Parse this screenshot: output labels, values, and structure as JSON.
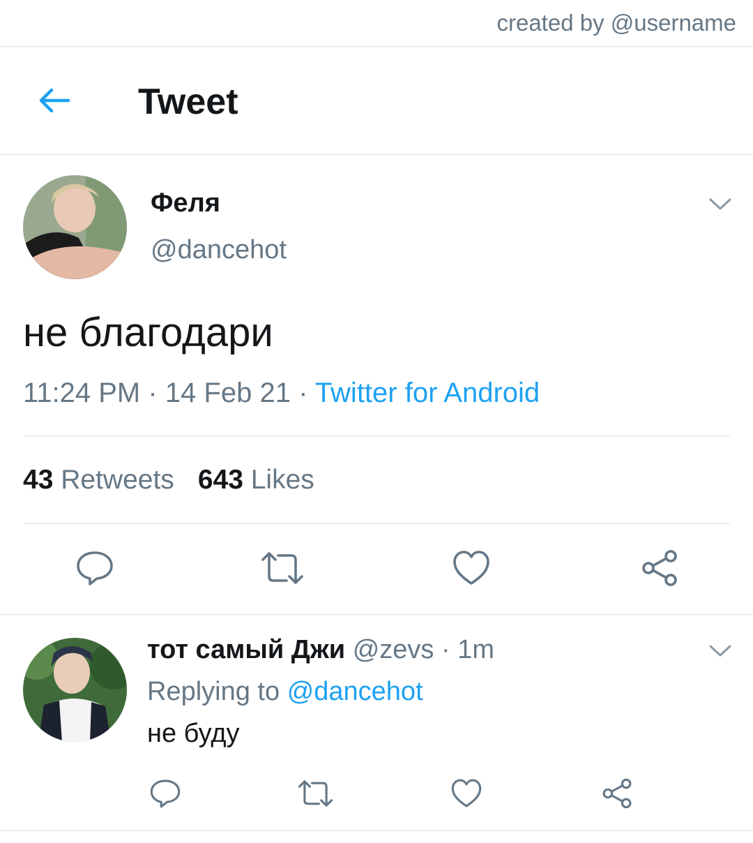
{
  "watermark": "created by @username",
  "header": {
    "title": "Tweet",
    "back_icon": "arrow-left-icon"
  },
  "tweet": {
    "author_name": "Феля",
    "author_handle": "@dancehot",
    "text": "не благодари",
    "time": "11:24 PM",
    "date": "14 Feb 21",
    "separator": "·",
    "source": "Twitter for Android",
    "retweets_count": "43",
    "retweets_label": "Retweets",
    "likes_count": "643",
    "likes_label": "Likes"
  },
  "reply": {
    "author_name": "тот самый Джи",
    "author_handle": "@zevs",
    "separator": "·",
    "time": "1m",
    "replying_prefix": "Replying to",
    "replying_to": "@dancehot",
    "text": "не буду"
  },
  "actions": [
    "reply-icon",
    "retweet-icon",
    "like-icon",
    "share-icon"
  ],
  "colors": {
    "accent": "#1da1f2",
    "secondary_text": "#657786",
    "icon": "#657786",
    "divider": "#dfe3e6"
  }
}
